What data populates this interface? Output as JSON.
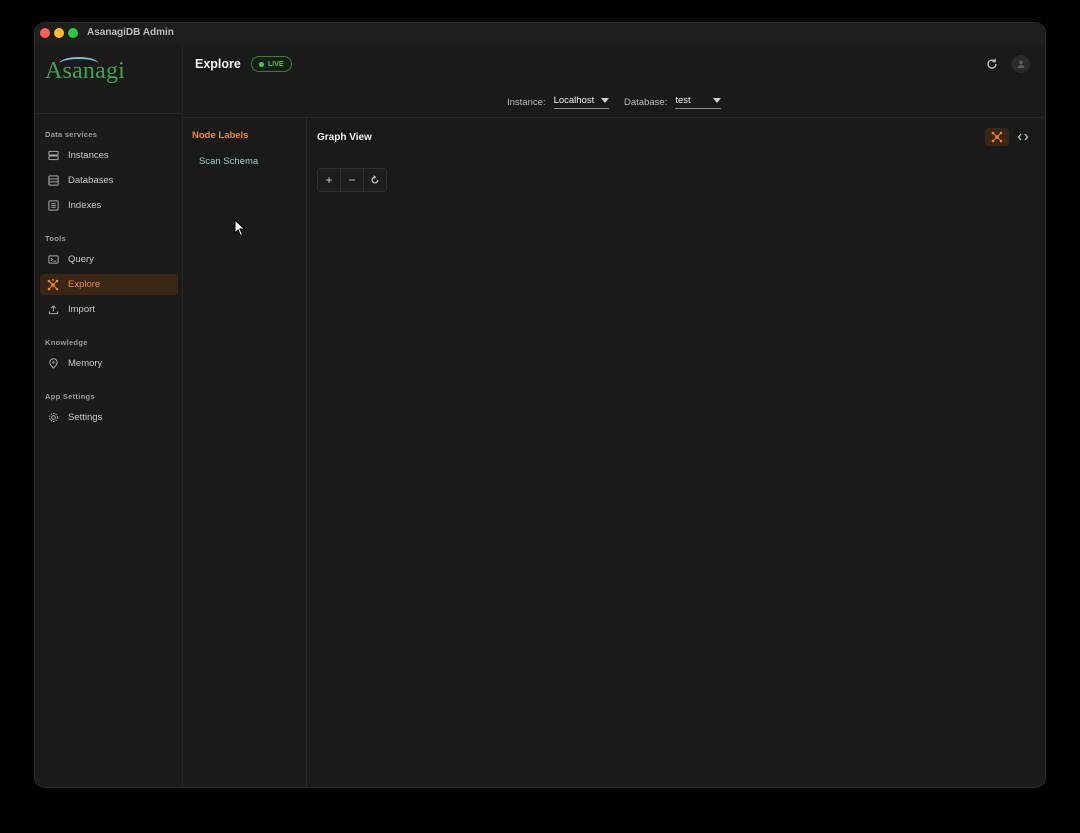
{
  "window": {
    "title": "AsanagiDB Admin"
  },
  "sidebar": {
    "logo": "Asanagi",
    "sections": [
      {
        "title": "Data services",
        "items": [
          {
            "label": "Instances",
            "icon": "server-icon"
          },
          {
            "label": "Databases",
            "icon": "database-icon"
          },
          {
            "label": "Indexes",
            "icon": "index-icon"
          }
        ]
      },
      {
        "title": "Tools",
        "items": [
          {
            "label": "Query",
            "icon": "terminal-icon"
          },
          {
            "label": "Explore",
            "icon": "graph-icon",
            "active": true
          },
          {
            "label": "Import",
            "icon": "upload-icon"
          }
        ]
      },
      {
        "title": "Knowledge",
        "items": [
          {
            "label": "Memory",
            "icon": "brain-icon"
          }
        ]
      },
      {
        "title": "App Settings",
        "items": [
          {
            "label": "Settings",
            "icon": "gear-icon"
          }
        ]
      }
    ]
  },
  "header": {
    "title": "Explore",
    "status_badge": "LIVE",
    "instance_label": "Instance:",
    "instance_value": "Localhost",
    "database_label": "Database:",
    "database_value": "test"
  },
  "node_panel": {
    "title": "Node Labels",
    "scan_label": "Scan Schema"
  },
  "graph": {
    "title": "Graph View",
    "zoom_in": "+",
    "zoom_out": "−"
  },
  "colors": {
    "accent": "#f08a24",
    "live": "#5dbb5d",
    "link": "#8fd4c8",
    "background": "#1a1a1a"
  }
}
